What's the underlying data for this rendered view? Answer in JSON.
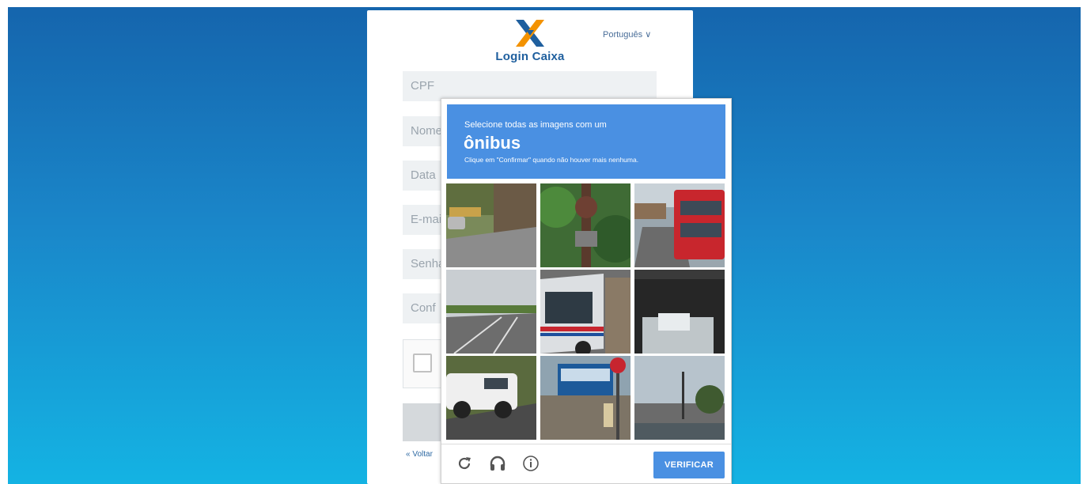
{
  "login": {
    "title": "Login Caixa",
    "language": "Português ∨",
    "fields": [
      "CPF",
      "Nome",
      "Data",
      "E-mail",
      "Senha",
      "Conf"
    ],
    "back_link": "« Voltar"
  },
  "captcha": {
    "instruction": "Selecione todas as imagens com um",
    "target": "ônibus",
    "hint": "Clique em \"Confirmar\" quando não houver mais nenhuma.",
    "verify_label": "VERIFICAR",
    "icons": [
      "reload-icon",
      "headphones-icon",
      "info-icon"
    ]
  },
  "colors": {
    "captcha_blue": "#4a90e2",
    "background_top": "#1565ad",
    "background_bottom": "#14b3e3",
    "logo_orange": "#f39200",
    "logo_blue": "#1f5f9e"
  }
}
